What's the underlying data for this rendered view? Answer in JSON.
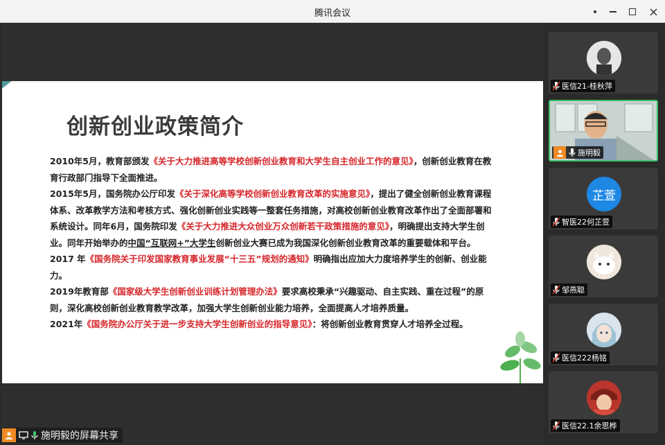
{
  "window": {
    "title": "腾讯会议"
  },
  "slide": {
    "title": "创新创业政策简介",
    "paragraphs": {
      "p1a": "2010年5月，教育部颁发",
      "p1b": "《关于大力推进高等学校创新创业教育和大学生自主创业工作的意见》",
      "p1c": "，创新创业教育在教育行政部门指导下全面推进。",
      "p2a": "2015年5月，国务院办公厅印发",
      "p2b": "《关于深化高等学校创新创业教育改革的实施意见》",
      "p2c": "，提出了健全创新创业教育课程体系、改革教学方法和考核方式、强化创新创业实践等一整套任务措施，对高校创新创业教育改革作出了全面部署和系统设计。同年6月，国务院印发",
      "p2d": "《关于大力推进大众创业万众创新若干政策措施的意见》",
      "p2e": "，明确提出支持大学生创业。同年开始举办的",
      "p2f": "中国“互联网+”大学生",
      "p2g": "创新创业大赛",
      "p2h": "已成为我国深化创新创业教育改革的重要载体和平台。",
      "p3a": "2017 年",
      "p3b": "《国务院关于印发国家教育事业发展“十三五”规划的通知》",
      "p3c": "明确指出应加大力度培养学生的创新、创业能力。",
      "p4a": "2019年教育部",
      "p4b": "《国家级大学生创新创业训练计划管理办法》",
      "p4c": "要求高校秉承“兴趣驱动、自主实践、重在过程”的原则，深化高校创新创业教育教学改革，加强大学生创新创业能力培养，全面提高人才培养质量。",
      "p5a": "2021年",
      "p5b": "《国务院办公厅关于进一步支持大学生创新创业的指导意见》",
      "p5c": "：将创新创业教育贯穿人才培养全过程。"
    }
  },
  "share_label": "施明毅的屏幕共享",
  "participants": [
    {
      "name": "医信21-桂秋萍"
    },
    {
      "name": "施明毅"
    },
    {
      "name": "智医22何芷萱",
      "avatar_text": "芷萱"
    },
    {
      "name": "邹燕聪"
    },
    {
      "name": "医信222杨铭"
    },
    {
      "name": "医信22.1余思桦"
    }
  ],
  "colors": {
    "accent_teal": "#4e9a9a",
    "emphasis_red": "#d7262a",
    "active_border": "#3cc36b",
    "host_orange": "#f08a24",
    "avatar_blue": "#1e88e5"
  }
}
